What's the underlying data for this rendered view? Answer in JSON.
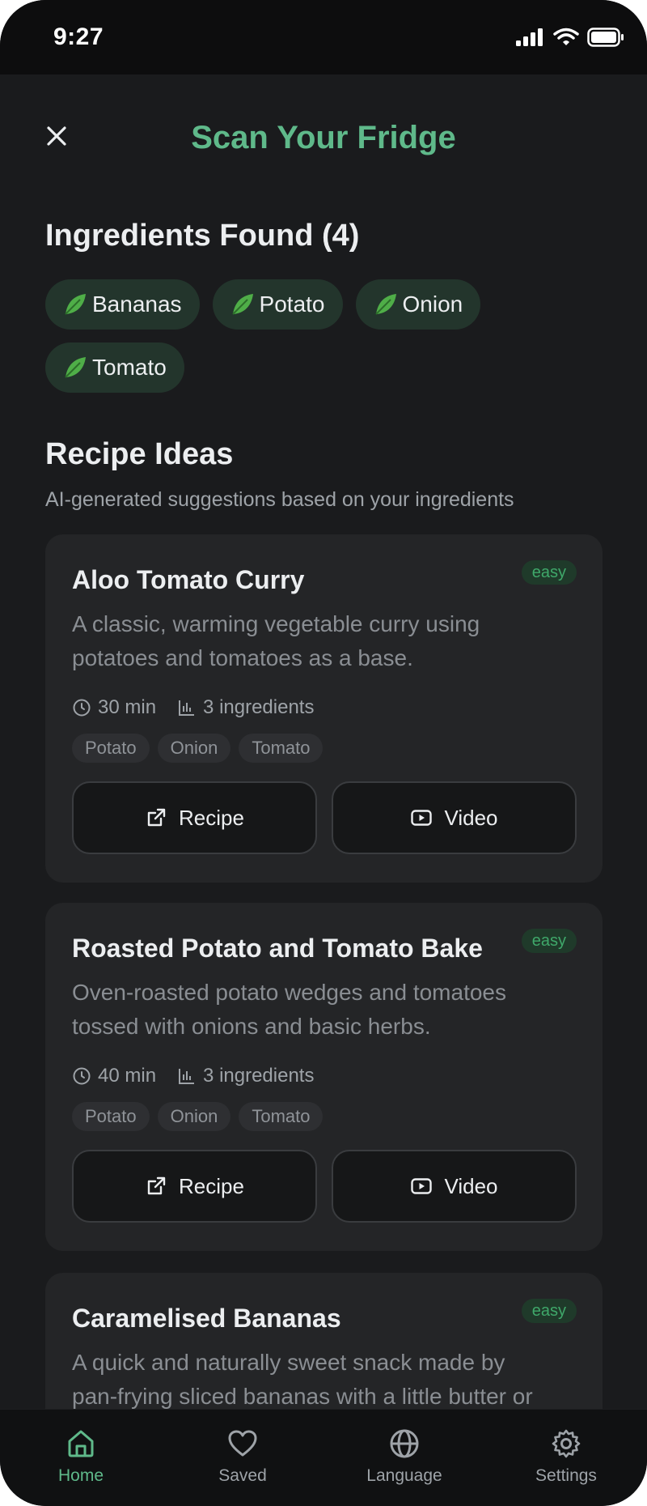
{
  "status": {
    "time": "9:27"
  },
  "header": {
    "title": "Scan Your Fridge"
  },
  "ingredients": {
    "heading": "Ingredients Found (4)",
    "items": [
      "Bananas",
      "Potato",
      "Onion",
      "Tomato"
    ]
  },
  "recipes": {
    "heading": "Recipe Ideas",
    "subtitle": "AI-generated suggestions based on your ingredients",
    "cards": [
      {
        "title": "Aloo Tomato Curry",
        "difficulty": "easy",
        "description_line1": "A classic, warming vegetable curry using",
        "description_line2": "potatoes and tomatoes as a base.",
        "time": "30 min",
        "ingredients_count": "3 ingredients",
        "tags": [
          "Potato",
          "Onion",
          "Tomato"
        ],
        "recipe_label": "Recipe",
        "video_label": "Video"
      },
      {
        "title": "Roasted Potato and Tomato Bake",
        "difficulty": "easy",
        "description_line1": "Oven-roasted potato wedges and tomatoes",
        "description_line2": "tossed with onions and basic herbs.",
        "time": "40 min",
        "ingredients_count": "3 ingredients",
        "tags": [
          "Potato",
          "Onion",
          "Tomato"
        ],
        "recipe_label": "Recipe",
        "video_label": "Video"
      },
      {
        "title": "Caramelised Bananas",
        "difficulty": "easy",
        "description_line1": "A quick and naturally sweet snack made by",
        "description_line2": "pan-frying sliced bananas with a little butter or"
      }
    ]
  },
  "tabbar": {
    "home": "Home",
    "saved": "Saved",
    "language": "Language",
    "settings": "Settings"
  },
  "colors": {
    "background": "#1a1b1d",
    "accent": "#5fb98a",
    "card": "#242527",
    "chip": "#23352c",
    "badge_text": "#3fa86a"
  }
}
